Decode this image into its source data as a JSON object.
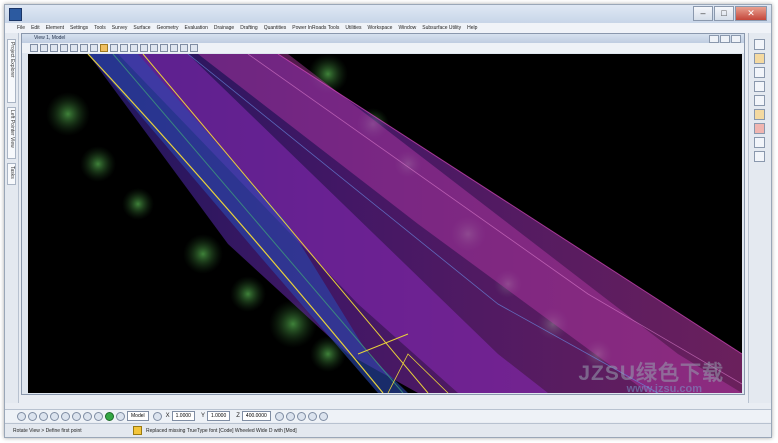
{
  "window": {
    "minimize_glyph": "–",
    "maximize_glyph": "□",
    "close_glyph": "✕"
  },
  "menu": [
    "File",
    "Edit",
    "Element",
    "Settings",
    "Tools",
    "Survey",
    "Surface",
    "Geometry",
    "Evaluation",
    "Drainage",
    "Drafting",
    "Quantities",
    "Power InRoads Tools",
    "Utilities",
    "Workspace",
    "Window",
    "Subsurface Utility",
    "Help"
  ],
  "left_panel_tabs": [
    "Project Explorer",
    "Left Pointer View",
    "Tasks"
  ],
  "view": {
    "title": "View 1, Model"
  },
  "bottom_toolbar": {
    "level_select": "Model",
    "x_label": "X",
    "x_value": "1.0000",
    "y_label": "Y",
    "y_value": "1.0000",
    "z_label": "Z",
    "z_value": "400.0000"
  },
  "status": {
    "prompt": "Rotate View > Define first point",
    "message": "Replaced missing TrueType font [Code] Wheeled Wide D with [Mod]"
  },
  "watermark": {
    "text": "JZSU绿色下载",
    "sub": "www.jzsu.com"
  },
  "colors": {
    "canvas_background": "#000000",
    "road_magenta": "#c23aa8",
    "road_purple": "#5a30c0",
    "road_blue": "#2a3aa8",
    "lane_yellow": "#e8d23a",
    "vegetation_green": "#3f8a3a"
  },
  "icons": {
    "app": "app-icon",
    "warning": "warning-icon",
    "tentative": "tentative-snap-icon"
  }
}
